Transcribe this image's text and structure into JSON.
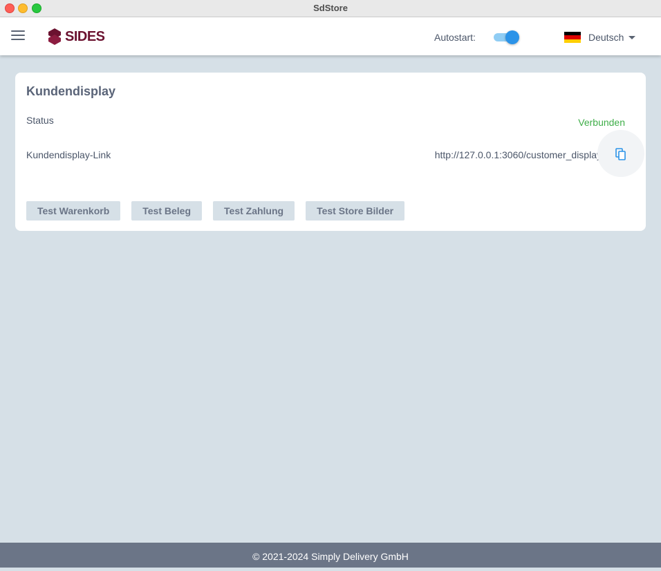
{
  "window": {
    "title": "SdStore"
  },
  "header": {
    "logo_text": "SIDES",
    "autostart_label": "Autostart:",
    "autostart_enabled": true,
    "language": "Deutsch",
    "colors": {
      "brand": "#6b1230",
      "toggle_accent": "#2b93e8"
    },
    "icons": {
      "menu": "hamburger-menu-icon",
      "flag": "germany-flag-icon",
      "caret": "caret-down-icon"
    }
  },
  "card": {
    "title": "Kundendisplay",
    "status_label": "Status",
    "status_value": "Verbunden",
    "status_color": "#3fae49",
    "link_label": "Kundendisplay-Link",
    "link_value": "http://127.0.0.1:3060/customer_display",
    "copy_icon": "copy-icon",
    "buttons": [
      "Test Warenkorb",
      "Test Beleg",
      "Test Zahlung",
      "Test Store Bilder"
    ]
  },
  "footer": {
    "text": "© 2021-2024 Simply Delivery GmbH"
  }
}
